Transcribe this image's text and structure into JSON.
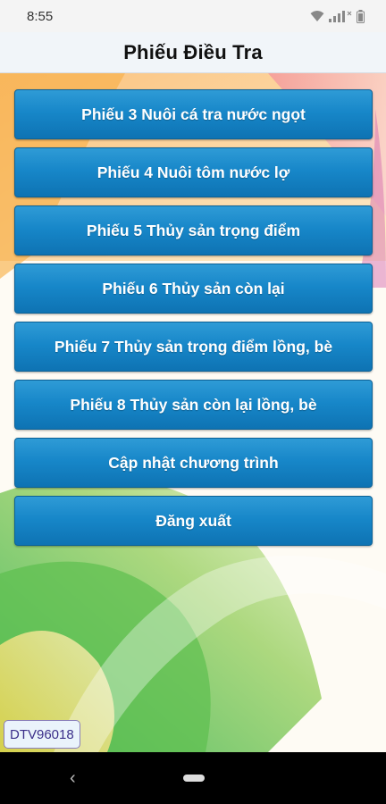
{
  "status_bar": {
    "time": "8:55",
    "icons": [
      "wifi-icon",
      "signal-icon",
      "battery-icon"
    ]
  },
  "header": {
    "title": "Phiếu Điều Tra"
  },
  "menu": {
    "items": [
      {
        "label": "Phiếu 3 Nuôi cá tra nước ngọt"
      },
      {
        "label": "Phiếu 4 Nuôi tôm nước lợ"
      },
      {
        "label": "Phiếu 5 Thủy sản trọng điểm"
      },
      {
        "label": "Phiếu 6 Thủy sản còn lại"
      },
      {
        "label": "Phiếu 7 Thủy sản trọng điểm lồng, bè"
      },
      {
        "label": "Phiếu 8 Thủy sản còn lại lồng, bè"
      },
      {
        "label": "Cập nhật chương trình"
      },
      {
        "label": "Đăng xuất"
      }
    ]
  },
  "footer": {
    "version": "DTV96018"
  },
  "nav": {
    "back": "‹",
    "home": "home-pill"
  },
  "colors": {
    "button_top": "#2f9bd6",
    "button_bottom": "#0e73b3",
    "header_bg": "#f1f5f9"
  }
}
